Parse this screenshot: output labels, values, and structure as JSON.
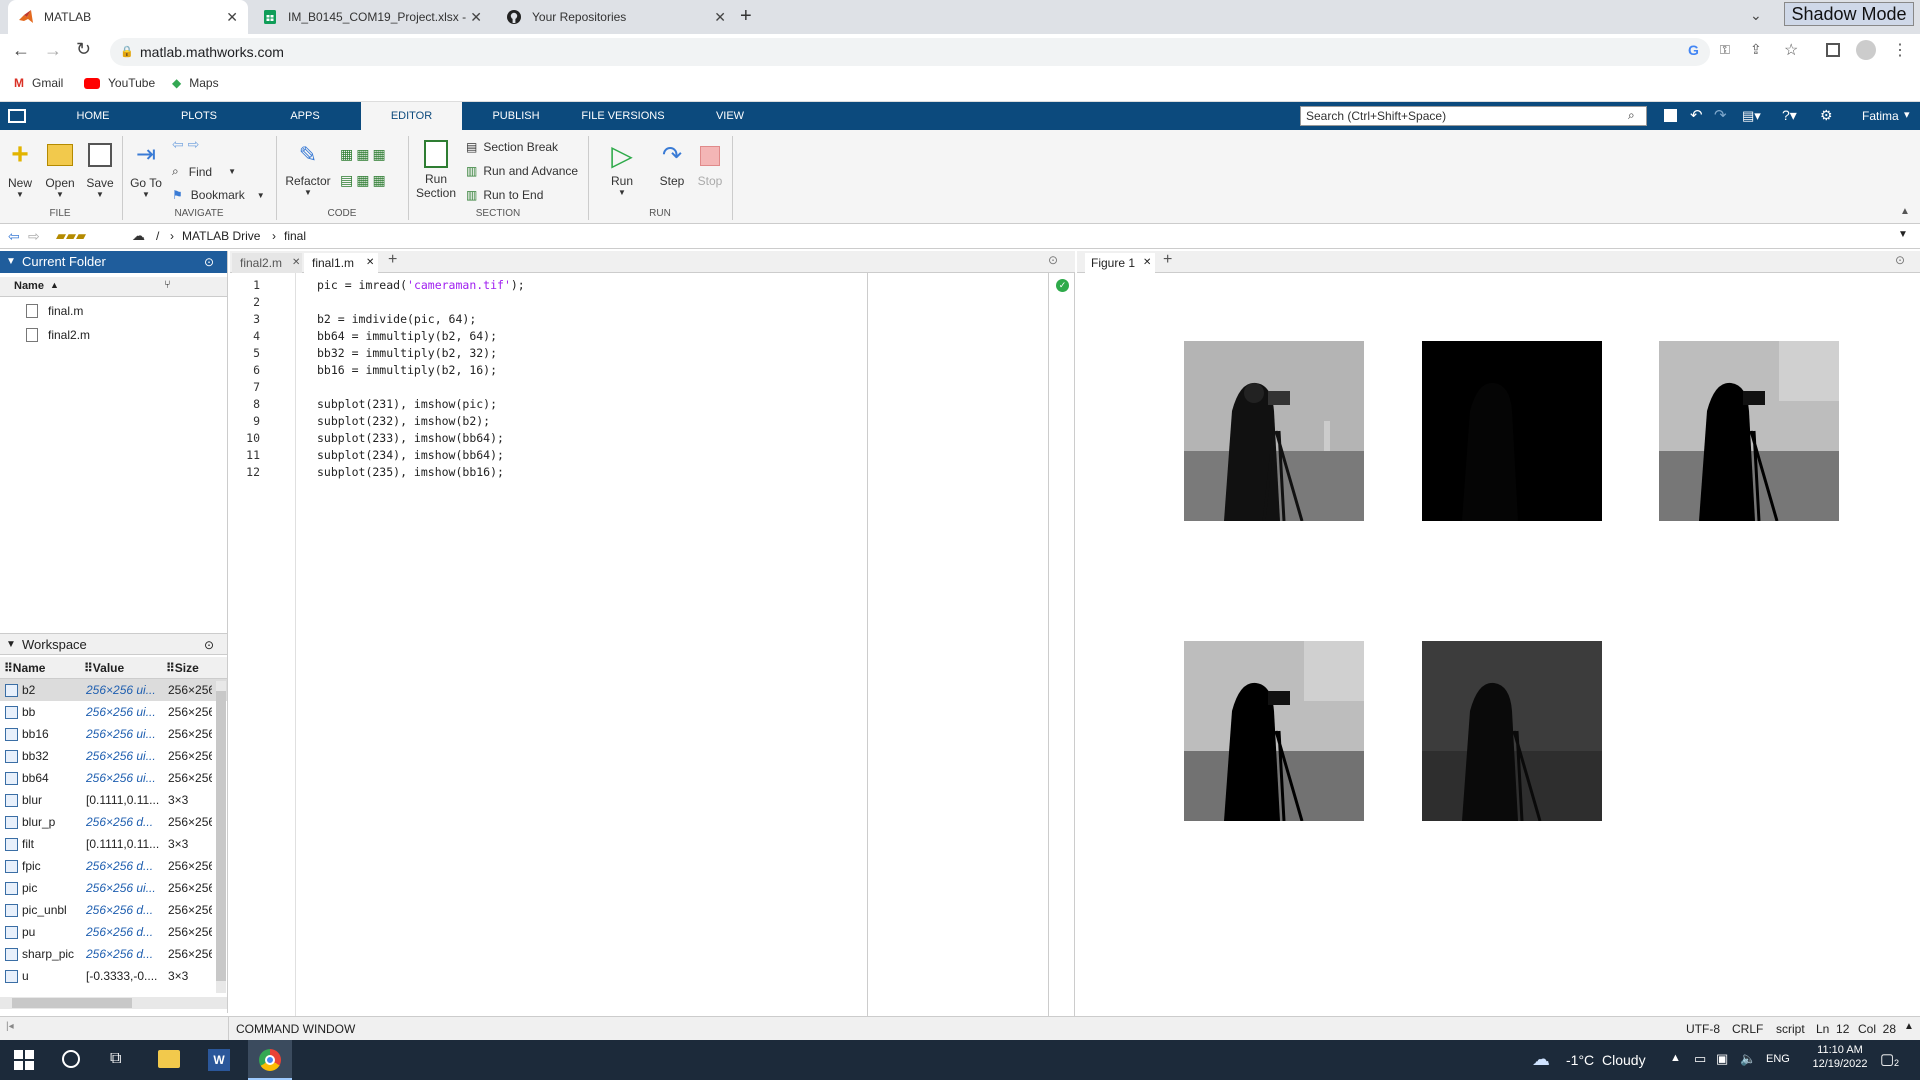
{
  "browser": {
    "tabs": [
      {
        "title": "MATLAB",
        "icon": "matlab-icon"
      },
      {
        "title": "IM_B0145_COM19_Project.xlsx - ",
        "icon": "sheets-icon"
      },
      {
        "title": "Your Repositories",
        "icon": "github-icon"
      }
    ],
    "shadow_mode": "Shadow Mode",
    "url": "matlab.mathworks.com",
    "bookmarks": [
      "Gmail",
      "YouTube",
      "Maps"
    ]
  },
  "matlab": {
    "tabs": [
      "HOME",
      "PLOTS",
      "APPS",
      "EDITOR",
      "PUBLISH",
      "FILE VERSIONS",
      "VIEW"
    ],
    "active_tab": "EDITOR",
    "search_placeholder": "Search (Ctrl+Shift+Space)",
    "user": "Fatima",
    "ribbon": {
      "file": {
        "new": "New",
        "open": "Open",
        "save": "Save",
        "group": "FILE"
      },
      "navigate": {
        "goto": "Go To",
        "find": "Find",
        "bookmark": "Bookmark",
        "group": "NAVIGATE"
      },
      "code": {
        "refactor": "Refactor",
        "group": "CODE"
      },
      "section": {
        "run_section_1": "Run",
        "run_section_2": "Section",
        "section_break": "Section Break",
        "run_advance": "Run and Advance",
        "run_end": "Run to End",
        "group": "SECTION"
      },
      "run": {
        "run": "Run",
        "step": "Step",
        "stop": "Stop",
        "group": "RUN"
      }
    },
    "path": {
      "root": "/",
      "drive": "MATLAB Drive",
      "folder": "final"
    },
    "current_folder": {
      "title": "Current Folder",
      "col_name": "Name",
      "files": [
        "final.m",
        "final2.m"
      ]
    },
    "workspace": {
      "title": "Workspace",
      "col_name": "Name",
      "col_value": "Value",
      "col_size": "Size",
      "vars": [
        {
          "name": "b2",
          "value": "256×256 ui...",
          "size": "256×256"
        },
        {
          "name": "bb",
          "value": "256×256 ui...",
          "size": "256×256"
        },
        {
          "name": "bb16",
          "value": "256×256 ui...",
          "size": "256×256"
        },
        {
          "name": "bb32",
          "value": "256×256 ui...",
          "size": "256×256"
        },
        {
          "name": "bb64",
          "value": "256×256 ui...",
          "size": "256×256"
        },
        {
          "name": "blur",
          "value": "[0.1111,0.11...",
          "size": "3×3"
        },
        {
          "name": "blur_p",
          "value": "256×256 d...",
          "size": "256×256"
        },
        {
          "name": "filt",
          "value": "[0.1111,0.11...",
          "size": "3×3"
        },
        {
          "name": "fpic",
          "value": "256×256 d...",
          "size": "256×256"
        },
        {
          "name": "pic",
          "value": "256×256 ui...",
          "size": "256×256"
        },
        {
          "name": "pic_unbl",
          "value": "256×256 d...",
          "size": "256×256"
        },
        {
          "name": "pu",
          "value": "256×256 d...",
          "size": "256×256"
        },
        {
          "name": "sharp_pic",
          "value": "256×256 d...",
          "size": "256×256"
        },
        {
          "name": "u",
          "value": "[-0.3333,-0....",
          "size": "3×3"
        }
      ]
    },
    "editor": {
      "tabs": [
        "final2.m",
        "final1.m"
      ],
      "active_tab": "final1.m",
      "lines": [
        {
          "n": "1",
          "pre": "pic = imread(",
          "str": "'cameraman.tif'",
          "post": ");"
        },
        {
          "n": "2",
          "pre": "",
          "str": "",
          "post": ""
        },
        {
          "n": "3",
          "pre": "b2 = imdivide(pic, 64);",
          "str": "",
          "post": ""
        },
        {
          "n": "4",
          "pre": "bb64 = immultiply(b2, 64);",
          "str": "",
          "post": ""
        },
        {
          "n": "5",
          "pre": "bb32 = immultiply(b2, 32);",
          "str": "",
          "post": ""
        },
        {
          "n": "6",
          "pre": "bb16 = immultiply(b2, 16);",
          "str": "",
          "post": ""
        },
        {
          "n": "7",
          "pre": "",
          "str": "",
          "post": ""
        },
        {
          "n": "8",
          "pre": "subplot(231), imshow(pic);",
          "str": "",
          "post": ""
        },
        {
          "n": "9",
          "pre": "subplot(232), imshow(b2);",
          "str": "",
          "post": ""
        },
        {
          "n": "10",
          "pre": "subplot(233), imshow(bb64);",
          "str": "",
          "post": ""
        },
        {
          "n": "11",
          "pre": "subplot(234), imshow(bb64);",
          "str": "",
          "post": ""
        },
        {
          "n": "12",
          "pre": "subplot(235), imshow(bb16);",
          "str": "",
          "post": ""
        }
      ]
    },
    "figure": {
      "tab": "Figure 1"
    },
    "command_window": "COMMAND WINDOW",
    "status": {
      "encoding": "UTF-8",
      "eol": "CRLF",
      "type": "script",
      "ln": "Ln  12",
      "col": "Col  28"
    }
  },
  "taskbar": {
    "weather_temp": "-1°C",
    "weather_desc": "Cloudy",
    "lang": "ENG",
    "time": "11:10 AM",
    "date": "12/19/2022",
    "notif_count": "2"
  }
}
